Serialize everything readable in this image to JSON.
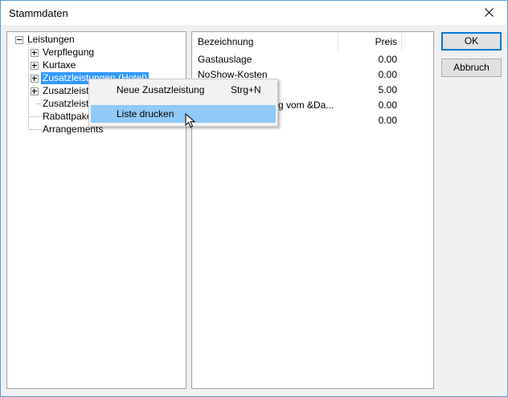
{
  "window": {
    "title": "Stammdaten",
    "close_icon": "close-icon"
  },
  "tree": {
    "root": "Leistungen",
    "items": [
      {
        "label": "Verpflegung"
      },
      {
        "label": "Kurtaxe"
      },
      {
        "label": "Zusatzleistungen (Hotel)"
      },
      {
        "label": "Zusatzleistu"
      },
      {
        "label": "Zusatzleistu"
      },
      {
        "label": "Rabattpake"
      },
      {
        "label": "Arrangements"
      }
    ]
  },
  "list": {
    "columns": {
      "name": "Bezeichnung",
      "price": "Preis"
    },
    "rows": [
      {
        "name": "Gastauslage",
        "price": "0.00"
      },
      {
        "name": "NoShow-Kosten",
        "price": "0.00"
      },
      {
        "name": "",
        "price": "5.00"
      },
      {
        "name": "g vom &Da...",
        "price": "0.00"
      },
      {
        "name": "",
        "price": "0.00"
      }
    ]
  },
  "buttons": {
    "ok": "OK",
    "cancel": "Abbruch"
  },
  "context_menu": {
    "items": [
      {
        "label": "Neue Zusatzleistung",
        "shortcut": "Strg+N"
      },
      {
        "label": "Liste drucken",
        "shortcut": ""
      }
    ]
  },
  "colors": {
    "selection": "#3399ff",
    "menu_highlight": "#91c9f7",
    "window_border": "#5b9bd5"
  }
}
